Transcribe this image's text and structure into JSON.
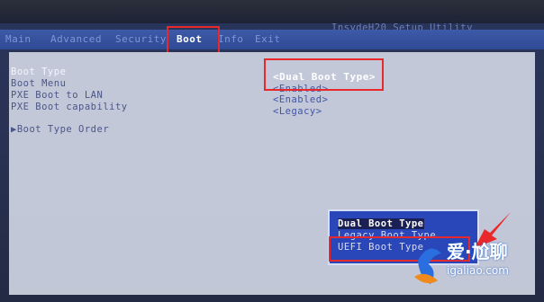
{
  "bios": {
    "title": "InsydeH20 Setup Utility",
    "tabs": [
      "Main",
      "Advanced",
      "Security",
      "Boot",
      "Info",
      "Exit"
    ],
    "active_tab": "Boot",
    "settings": [
      {
        "label": "Boot Type",
        "value": "<Dual Boot Type>"
      },
      {
        "label": "Boot Menu",
        "value": "<Enabled>"
      },
      {
        "label": "PXE Boot to LAN",
        "value": "<Enabled>"
      },
      {
        "label": "PXE Boot capability",
        "value": "<Legacy>"
      }
    ],
    "submenu": "▶Boot Type Order",
    "popup_options": [
      "Dual Boot Type",
      "Legacy Boot Type",
      "UEFI Boot Type"
    ],
    "popup_selected": "Dual Boot Type"
  },
  "watermark": {
    "logo_text": "爱·尬聊",
    "url": "igaliao.com"
  },
  "colors": {
    "highlight_box": "#e8282a",
    "popup_bg": "#2a47b9",
    "screen_bg": "#2a3356"
  }
}
